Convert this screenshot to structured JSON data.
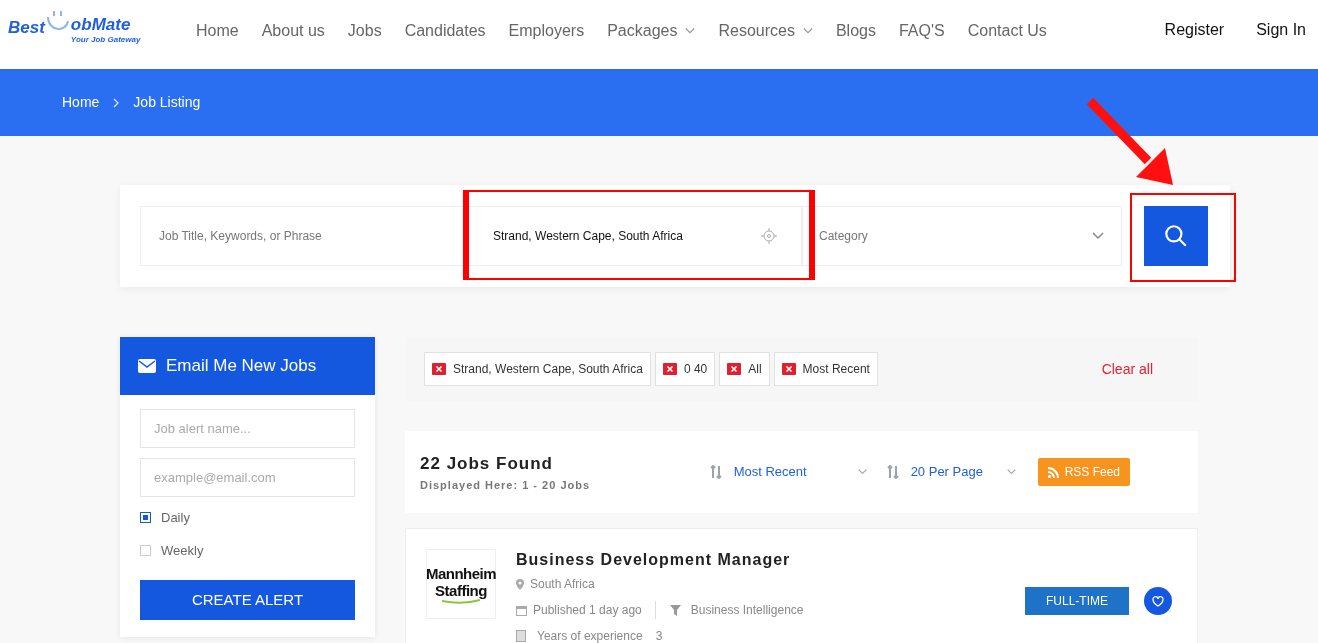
{
  "logo": {
    "word_1": "Best",
    "word_2": "obMate",
    "tagline": "Your Job Gateway"
  },
  "nav": [
    {
      "label": "Home",
      "dropdown": false
    },
    {
      "label": "About us",
      "dropdown": false
    },
    {
      "label": "Jobs",
      "dropdown": false
    },
    {
      "label": "Candidates",
      "dropdown": false
    },
    {
      "label": "Employers",
      "dropdown": false
    },
    {
      "label": "Packages",
      "dropdown": true
    },
    {
      "label": "Resources",
      "dropdown": true
    },
    {
      "label": "Blogs",
      "dropdown": false
    },
    {
      "label": "FAQ'S",
      "dropdown": false
    },
    {
      "label": "Contact Us",
      "dropdown": false
    }
  ],
  "account": [
    "Register",
    "Sign In"
  ],
  "breadcrumb": [
    "Home",
    "Job Listing"
  ],
  "search": {
    "keywords": {
      "placeholder": "Job Title, Keywords, or Phrase"
    },
    "location": {
      "value": "Strand, Western Cape, South Africa"
    },
    "category": {
      "placeholder": "Category"
    }
  },
  "alert": {
    "title": "Email Me New Jobs",
    "name_field": {
      "placeholder": "Job alert name..."
    },
    "email_field": {
      "placeholder": "example@email.com"
    },
    "frequency": [
      {
        "label": "Daily",
        "checked": true
      },
      {
        "label": "Weekly",
        "checked": false
      }
    ],
    "button": "CREATE ALERT"
  },
  "filters": [
    "Strand, Western Cape, South Africa",
    "0 40",
    "All",
    "Most Recent"
  ],
  "clear_all": "Clear all",
  "results": {
    "title": "22 Jobs Found",
    "subtitle": "Displayed Here: 1 - 20 Jobs",
    "sort": "Most Recent",
    "per_page": "20 Per Page",
    "rss": "RSS Feed"
  },
  "jobs": [
    {
      "company_logo": [
        "Mannheim",
        "Staffing"
      ],
      "title": "Business Development Manager",
      "location": "South Africa",
      "published": "Published 1 day ago",
      "category": "Business Intelligence",
      "experience_label": "Years of experience",
      "experience": "3",
      "type": "FULL-TIME"
    }
  ]
}
